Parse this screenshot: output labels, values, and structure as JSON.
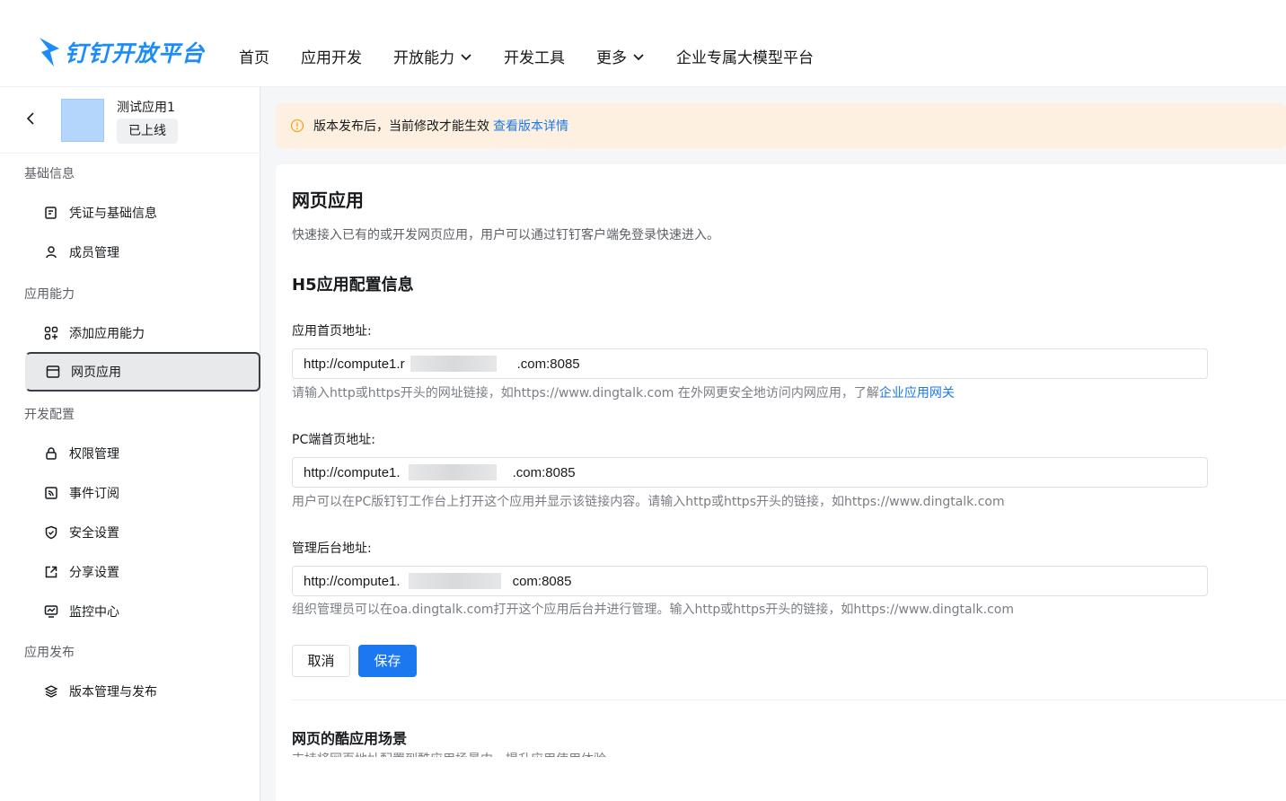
{
  "brand": {
    "name": "钉钉开放平台",
    "color": "#1b8cfa"
  },
  "nav": {
    "items": [
      {
        "label": "首页",
        "dropdown": false
      },
      {
        "label": "应用开发",
        "dropdown": false
      },
      {
        "label": "开放能力",
        "dropdown": true
      },
      {
        "label": "开发工具",
        "dropdown": false
      },
      {
        "label": "更多",
        "dropdown": true
      },
      {
        "label": "企业专属大模型平台",
        "dropdown": false
      }
    ]
  },
  "app": {
    "name": "测试应用1",
    "status": "已上线"
  },
  "sidebar": {
    "groups": [
      {
        "title": "基础信息",
        "items": [
          {
            "label": "凭证与基础信息",
            "icon": "credential-icon"
          },
          {
            "label": "成员管理",
            "icon": "person-icon"
          }
        ]
      },
      {
        "title": "应用能力",
        "items": [
          {
            "label": "添加应用能力",
            "icon": "grid-plus-icon"
          },
          {
            "label": "网页应用",
            "icon": "browser-icon",
            "active": true
          }
        ]
      },
      {
        "title": "开发配置",
        "items": [
          {
            "label": "权限管理",
            "icon": "lock-icon"
          },
          {
            "label": "事件订阅",
            "icon": "rss-icon"
          },
          {
            "label": "安全设置",
            "icon": "shield-icon"
          },
          {
            "label": "分享设置",
            "icon": "share-icon"
          },
          {
            "label": "监控中心",
            "icon": "monitor-icon"
          }
        ]
      },
      {
        "title": "应用发布",
        "items": [
          {
            "label": "版本管理与发布",
            "icon": "layers-icon"
          }
        ]
      }
    ]
  },
  "notice": {
    "text": "版本发布后，当前修改才能生效",
    "link": "查看版本详情"
  },
  "page": {
    "title": "网页应用",
    "description": "快速接入已有的或开发网页应用，用户可以通过钉钉客户端免登录快速进入。",
    "section_title": "H5应用配置信息"
  },
  "fields": {
    "home": {
      "label": "应用首页地址:",
      "value": "http://compute1.r                              .com:8085",
      "hint": "请输入http或https开头的网址链接，如https://www.dingtalk.com 在外网更安全地访问内网应用，了解",
      "hint_link": "企业应用网关"
    },
    "pc": {
      "label": "PC端首页地址:",
      "value": "http://compute1.                              .com:8085",
      "hint": "用户可以在PC版钉钉工作台上打开这个应用并显示该链接内容。请输入http或https开头的链接，如https://www.dingtalk.com"
    },
    "admin": {
      "label": "管理后台地址:",
      "value": "http://compute1.                              com:8085",
      "hint": "组织管理员可以在oa.dingtalk.com打开这个应用后台并进行管理。输入http或https开头的链接，如https://www.dingtalk.com"
    }
  },
  "buttons": {
    "cancel": "取消",
    "save": "保存"
  },
  "scenario": {
    "title": "网页的酷应用场景",
    "description": "支持将网页地址配置到酷应用场景中，提升应用使用体验"
  }
}
